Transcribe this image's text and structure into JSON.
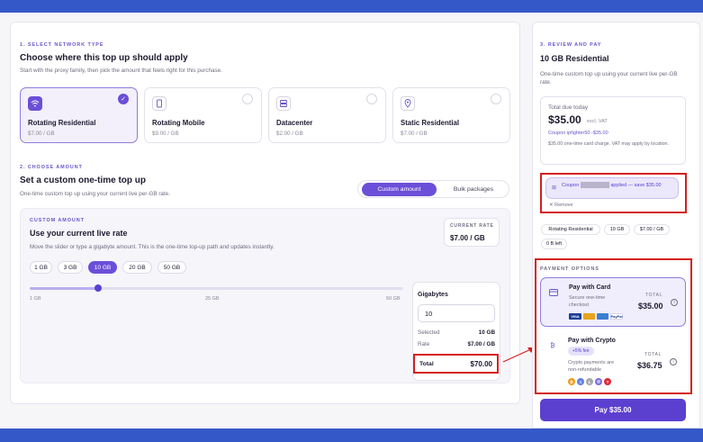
{
  "left": {
    "step1": "1. SELECT NETWORK TYPE",
    "title1": "Choose where this top up should apply",
    "sub1": "Start with the proxy family, then pick the amount that feels right for this purchase.",
    "cards": [
      {
        "name": "Rotating Residential",
        "price": "$7.00 / GB",
        "icon": "wifi-icon"
      },
      {
        "name": "Rotating Mobile",
        "price": "$9.00 / GB",
        "icon": "mobile-icon"
      },
      {
        "name": "Datacenter",
        "price": "$2.00 / GB",
        "icon": "server-icon"
      },
      {
        "name": "Static Residential",
        "price": "$7.00 / GB",
        "icon": "location-pin-icon"
      }
    ],
    "step2": "2. CHOOSE AMOUNT",
    "title2": "Set a custom one-time top up",
    "sub2": "One-time custom top up using your current live per-GB rate.",
    "mode_active": "Custom amount",
    "mode_other": "Bulk packages",
    "custom": {
      "eyebrow": "CUSTOM AMOUNT",
      "title": "Use your current live rate",
      "desc": "Move the slider or type a gigabyte amount. This is the one-time top-up path and updates instantly.",
      "rate_label": "CURRENT RATE",
      "rate_value": "$7.00 / GB",
      "chips": [
        "1 GB",
        "3 GB",
        "10 GB",
        "20 GB",
        "50 GB"
      ],
      "selected_chip": "10 GB",
      "slider": {
        "min": 1,
        "max": 50,
        "value": 10,
        "min_label": "1 GB",
        "mid_label": "25 GB",
        "max_label": "50 GB"
      },
      "gb_label": "Gigabytes",
      "gb_value": "10",
      "selected_label": "Selected",
      "selected_value": "10 GB",
      "rate_row_label": "Rate",
      "rate_row_value": "$7.00 / GB",
      "total_label": "Total",
      "total_value": "$70.00"
    }
  },
  "right": {
    "step3": "3. REVIEW AND PAY",
    "title": "10 GB Residential",
    "desc": "One-time custom top up using your current live per-GB rate.",
    "due_label": "Total due today",
    "due_amount": "$35.00",
    "due_vat": "excl. VAT",
    "coupon_line": "Coupon ipfighter50 -$35.00",
    "note": "$35.00 one-time card charge. VAT may apply by location.",
    "coupon_pre": "Coupon",
    "coupon_post": "applied — save $35.00",
    "remove": "✕ Remove",
    "pills": [
      "Rotating Residential",
      "10 GB",
      "$7.00 / GB",
      "0 B left"
    ],
    "payment_label": "PAYMENT OPTIONS",
    "card": {
      "name": "Pay with Card",
      "desc": "Secure one-time checkout",
      "total_label": "TOTAL",
      "total": "$35.00",
      "logos": [
        "VISA",
        "MC",
        "AMEX",
        "PayPal"
      ]
    },
    "crypto": {
      "name": "Pay with Crypto",
      "fee": "+5% fee",
      "desc": "Crypto payments are non-refundable",
      "total_label": "TOTAL",
      "total": "$36.75",
      "coins": [
        "₿",
        "Ξ",
        "Ł",
        "◎",
        "T"
      ]
    },
    "pay_button": "Pay $35.00"
  },
  "colors": {
    "accent": "#6b4fd8",
    "topbar": "#3558c9",
    "highlight": "#d51f1f"
  }
}
